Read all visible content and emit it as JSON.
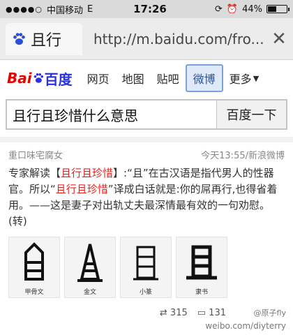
{
  "status": {
    "signal": "●●●●○",
    "carrier": "中国移动",
    "network": "E",
    "time": "17:26",
    "battery": "44%",
    "battery_level": 0.44
  },
  "browser": {
    "tab_title": "且行",
    "url": "http://m.baidu.com/fro..."
  },
  "nav": {
    "logo_bai": "Bai",
    "logo_du": "百度",
    "items": [
      "网页",
      "地图",
      "贴吧",
      "微博",
      "更多"
    ],
    "active": "微博"
  },
  "search": {
    "query": "且行且珍惜什么意思",
    "button": "百度一下"
  },
  "result": {
    "author": "重口味宅腐女",
    "time_source": "今天13:55/新浪微博",
    "text_prefix": "专家解读【",
    "text_hl1": "且行且珍惜",
    "text_mid1": "】:“且”在古汉语是指代男人的性器官。所以“",
    "text_hl2": "且行且珍惜",
    "text_suffix": "”译成白话就是:你的屌再行,也得省着用。——这是妻子对出轨丈夫最深情最有效的一句劝慰。 (转)",
    "images": [
      {
        "caption": "甲骨文",
        "icon": "oracle-glyph"
      },
      {
        "caption": "金文",
        "icon": "bronze-glyph"
      },
      {
        "caption": "小篆",
        "icon": "seal-glyph"
      },
      {
        "caption": "隶书",
        "icon": "clerical-glyph"
      }
    ],
    "reposts": "315",
    "comments": "131",
    "watermark_user": "@原子fly",
    "watermark_site": "weibo.com/diyterry"
  }
}
